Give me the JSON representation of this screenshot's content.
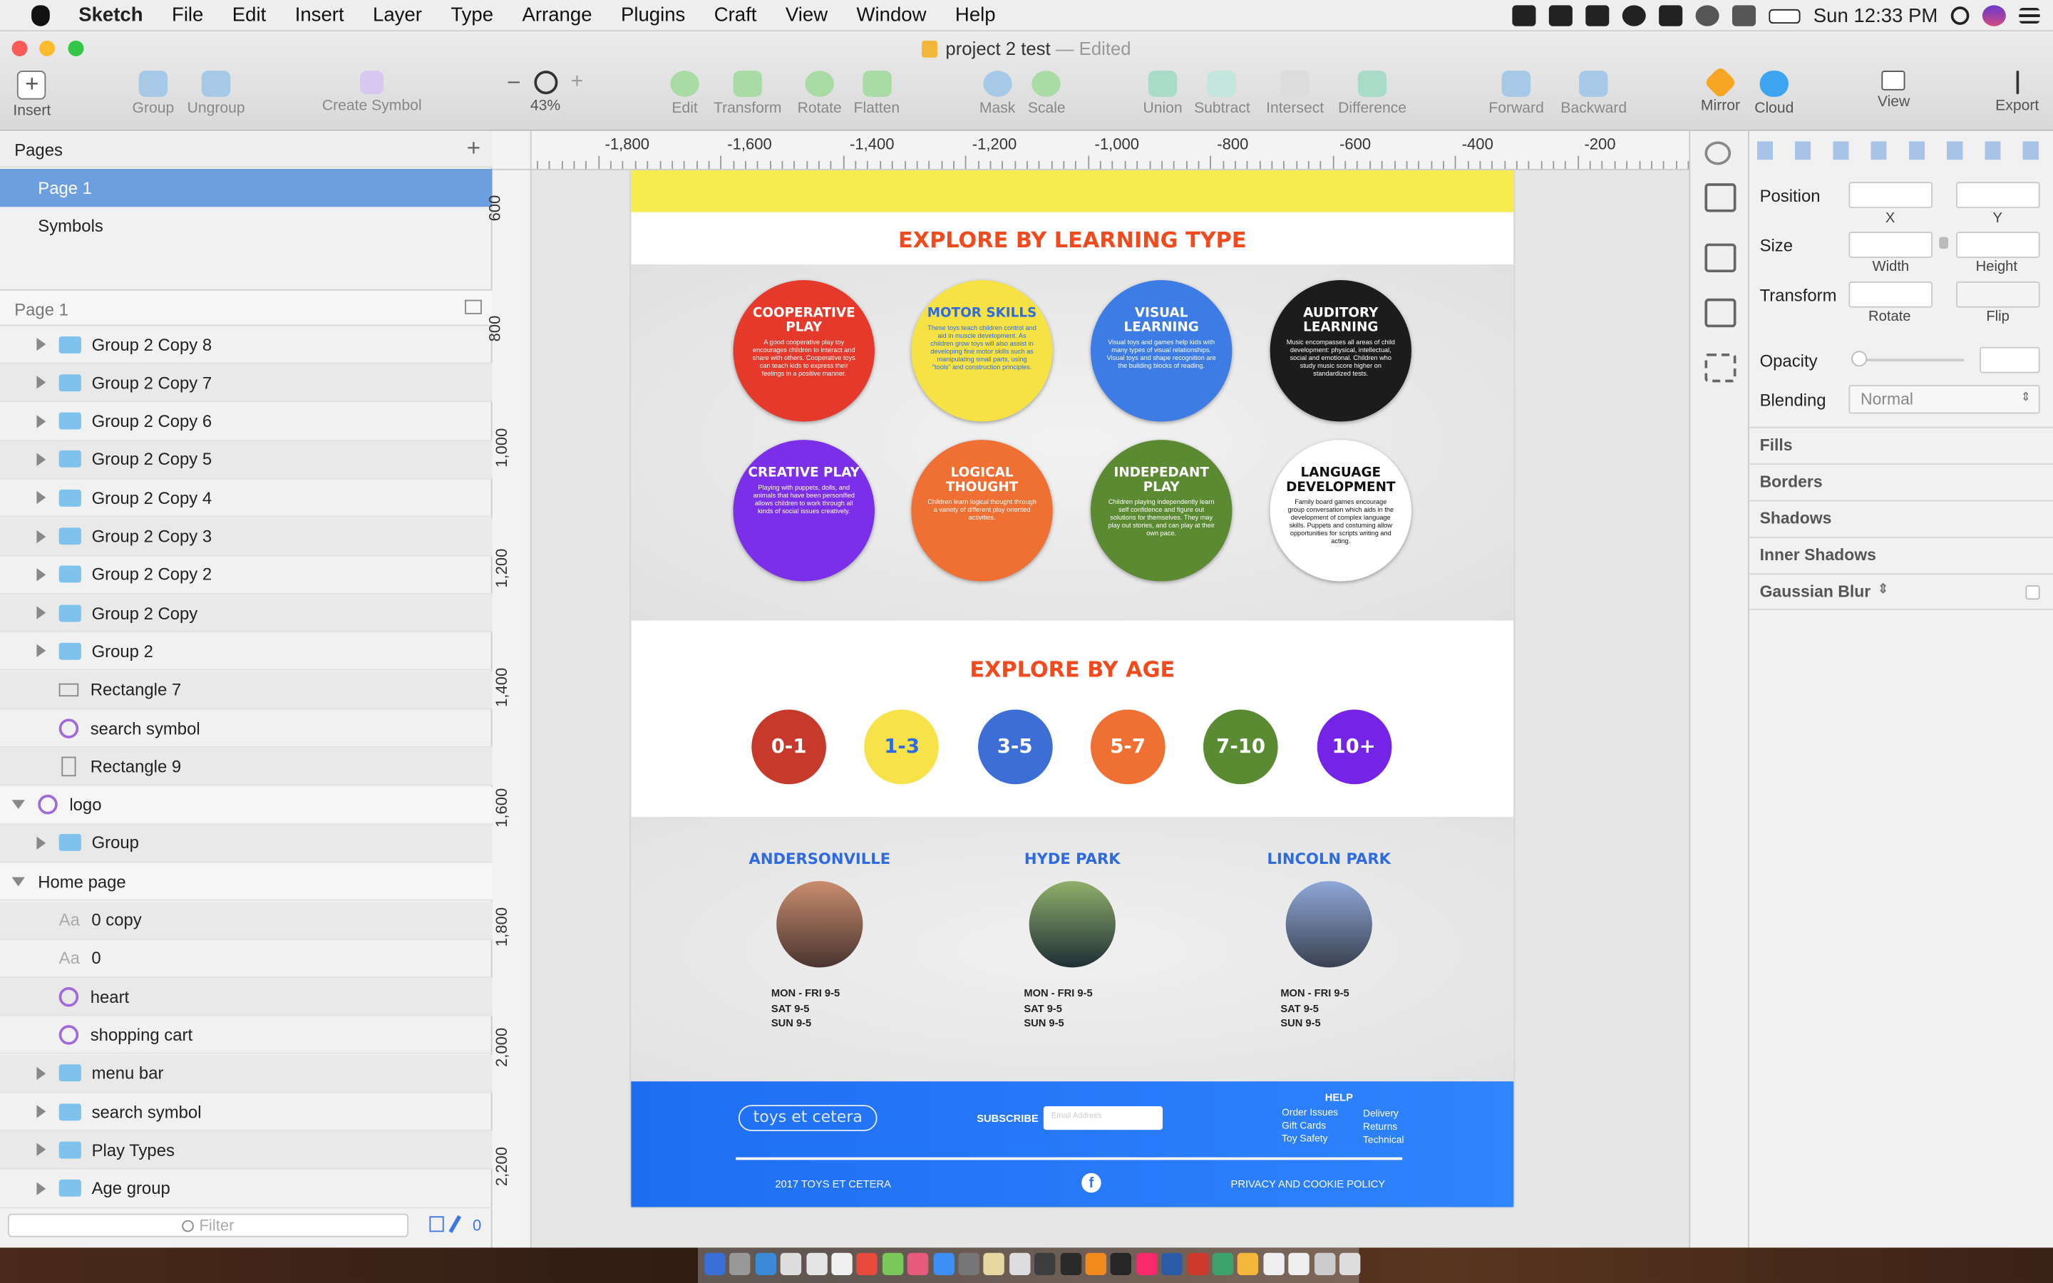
{
  "menubar": {
    "app": "Sketch",
    "items": [
      "File",
      "Edit",
      "Insert",
      "Layer",
      "Type",
      "Arrange",
      "Plugins",
      "Craft",
      "View",
      "Window",
      "Help"
    ],
    "clock": "Sun 12:33 PM"
  },
  "window": {
    "title": "project 2 test",
    "status": "— Edited"
  },
  "toolbar": {
    "insert": "Insert",
    "group": "Group",
    "ungroup": "Ungroup",
    "create_symbol": "Create Symbol",
    "zoom_minus": "–",
    "zoom_plus": "+",
    "zoom": "43%",
    "edit": "Edit",
    "transform": "Transform",
    "rotate": "Rotate",
    "flatten": "Flatten",
    "mask": "Mask",
    "scale": "Scale",
    "union": "Union",
    "subtract": "Subtract",
    "intersect": "Intersect",
    "difference": "Difference",
    "forward": "Forward",
    "backward": "Backward",
    "mirror": "Mirror",
    "cloud": "Cloud",
    "view": "View",
    "export": "Export"
  },
  "pages": {
    "header": "Pages",
    "add": "+",
    "items": [
      "Page 1",
      "Symbols"
    ],
    "current": "Page 1"
  },
  "layers": [
    {
      "name": "Group 2 Copy 8",
      "icon": "folder",
      "indent": 1,
      "expand": "right"
    },
    {
      "name": "Group 2 Copy 7",
      "icon": "folder",
      "indent": 1,
      "expand": "right"
    },
    {
      "name": "Group 2 Copy 6",
      "icon": "folder",
      "indent": 1,
      "expand": "right"
    },
    {
      "name": "Group 2 Copy 5",
      "icon": "folder",
      "indent": 1,
      "expand": "right"
    },
    {
      "name": "Group 2 Copy 4",
      "icon": "folder",
      "indent": 1,
      "expand": "right"
    },
    {
      "name": "Group 2 Copy 3",
      "icon": "folder",
      "indent": 1,
      "expand": "right"
    },
    {
      "name": "Group 2 Copy 2",
      "icon": "folder",
      "indent": 1,
      "expand": "right"
    },
    {
      "name": "Group 2 Copy",
      "icon": "folder",
      "indent": 1,
      "expand": "right"
    },
    {
      "name": "Group 2",
      "icon": "folder",
      "indent": 1,
      "expand": "right"
    },
    {
      "name": "Rectangle 7",
      "icon": "rect",
      "indent": 1,
      "expand": ""
    },
    {
      "name": "search symbol",
      "icon": "symbol",
      "indent": 1,
      "expand": ""
    },
    {
      "name": "Rectangle 9",
      "icon": "rectv",
      "indent": 1,
      "expand": ""
    },
    {
      "name": "logo",
      "icon": "symbol",
      "indent": 0,
      "expand": "down"
    },
    {
      "name": "Group",
      "icon": "folder",
      "indent": 1,
      "expand": "right"
    },
    {
      "name": "Home page",
      "icon": "",
      "indent": 0,
      "expand": "down"
    },
    {
      "name": "0 copy",
      "icon": "text",
      "indent": 1,
      "expand": ""
    },
    {
      "name": "0",
      "icon": "text",
      "indent": 1,
      "expand": ""
    },
    {
      "name": "heart",
      "icon": "symbol",
      "indent": 1,
      "expand": ""
    },
    {
      "name": "shopping cart",
      "icon": "symbol",
      "indent": 1,
      "expand": ""
    },
    {
      "name": "menu bar",
      "icon": "folder",
      "indent": 1,
      "expand": "right"
    },
    {
      "name": "search symbol",
      "icon": "folder",
      "indent": 1,
      "expand": "right"
    },
    {
      "name": "Play Types",
      "icon": "folder",
      "indent": 1,
      "expand": "right"
    },
    {
      "name": "Age group",
      "icon": "folder",
      "indent": 1,
      "expand": "right"
    }
  ],
  "filter": {
    "placeholder": "Filter",
    "count": "0"
  },
  "rulers": {
    "top": [
      "-1,800",
      "-1,600",
      "-1,400",
      "-1,200",
      "-1,000",
      "-800",
      "-600",
      "-400",
      "-200"
    ],
    "left": [
      "600",
      "800",
      "1,000",
      "1,200",
      "1,400",
      "1,600",
      "1,800",
      "2,000",
      "2,200"
    ]
  },
  "artboard": {
    "learning_title": "EXPLORE BY LEARNING TYPE",
    "learning": [
      {
        "title": "COOPERATIVE PLAY",
        "color": "#e53a2b",
        "text": "#ffffff",
        "desc": "A good cooperative play toy encourages children to interact and share with others. Cooperative toys can teach kids to express their feelings in a positive manner."
      },
      {
        "title": "MOTOR SKILLS",
        "color": "#f7e245",
        "text": "#2f6be0",
        "desc": "These toys teach children control and aid in muscle development. As children grow toys will also assist in developing fine motor skills such as manipulating small parts, using \"tools\" and construction principles."
      },
      {
        "title": "VISUAL LEARNING",
        "color": "#3d7be5",
        "text": "#ffffff",
        "desc": "Visual toys and games help kids with many types of visual relationships. Visual toys and shape recognition are the building blocks of reading."
      },
      {
        "title": "AUDITORY LEARNING",
        "color": "#1c1c1c",
        "text": "#ffffff",
        "desc": "Music encompasses all areas of child development: physical, intellectual, social and emotional. Children who study music score higher on standardized tests."
      },
      {
        "title": "CREATIVE PLAY",
        "color": "#7b2fe8",
        "text": "#ffffff",
        "desc": "Playing with puppets, dolls, and animals that have been personified allows children to work through all kinds of social issues creatively."
      },
      {
        "title": "LOGICAL THOUGHT",
        "color": "#f06f32",
        "text": "#ffffff",
        "desc": "Children learn logical thought through a variety of different play oriented activities."
      },
      {
        "title": "INDEPEDANT PLAY",
        "color": "#5c8a32",
        "text": "#ffffff",
        "desc": "Children playing independently learn self confidence and figure out solutions for themselves. They may play out stories, and can play at their own pace."
      },
      {
        "title": "LANGUAGE DEVELOPMENT",
        "color": "#ffffff",
        "text": "#111111",
        "desc": "Family board games encourage group conversation which aids in the development of complex language skills. Puppets and costuming allow opportunities for scripts writing and acting."
      }
    ],
    "age_title": "EXPLORE BY AGE",
    "ages": [
      {
        "label": "0-1",
        "color": "#c73a2b",
        "text": "#ffffff"
      },
      {
        "label": "1-3",
        "color": "#f7e24a",
        "text": "#2f6be0"
      },
      {
        "label": "3-5",
        "color": "#3c6ed6",
        "text": "#ffffff"
      },
      {
        "label": "5-7",
        "color": "#f06f32",
        "text": "#ffffff"
      },
      {
        "label": "7-10",
        "color": "#5a8b33",
        "text": "#ffffff"
      },
      {
        "label": "10+",
        "color": "#7523e6",
        "text": "#ffffff"
      }
    ],
    "locations": [
      {
        "name": "ANDERSONVILLE",
        "hours": [
          "MON - FRI 9-5",
          "SAT 9-5",
          "SUN 9-5"
        ],
        "photo": [
          "#c98d6e",
          "#4a3430"
        ]
      },
      {
        "name": "HYDE PARK",
        "hours": [
          "MON - FRI 9-5",
          "SAT 9-5",
          "SUN 9-5"
        ],
        "photo": [
          "#8fb06a",
          "#1f2e36"
        ]
      },
      {
        "name": "LINCOLN PARK",
        "hours": [
          "MON - FRI 9-5",
          "SAT 9-5",
          "SUN 9-5"
        ],
        "photo": [
          "#8fa7d8",
          "#3a4250"
        ]
      }
    ],
    "footer": {
      "logo": "toys et cetera",
      "subscribe": "SUBSCRIBE",
      "email_placeholder": "Email Address",
      "help": "HELP",
      "links_left": [
        "Order Issues",
        "Gift Cards",
        "Toy Safety"
      ],
      "links_right": [
        "Delivery",
        "Returns",
        "Technical"
      ],
      "copyright": "2017 TOYS ET CETERA",
      "policy": "PRIVACY AND COOKIE POLICY"
    }
  },
  "inspector": {
    "position": "Position",
    "x": "X",
    "y": "Y",
    "size": "Size",
    "width": "Width",
    "height": "Height",
    "transform": "Transform",
    "rotate": "Rotate",
    "flip": "Flip",
    "opacity": "Opacity",
    "blending": "Blending",
    "blend_mode": "Normal",
    "sections": [
      "Fills",
      "Borders",
      "Shadows",
      "Inner Shadows",
      "Gaussian Blur"
    ]
  }
}
